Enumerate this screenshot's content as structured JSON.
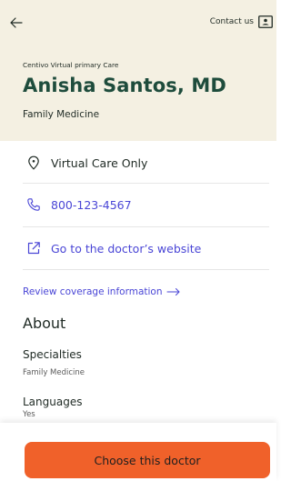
{
  "header": {
    "contact_label": "Contact us",
    "org": "Centivo Virtual primary Care",
    "doctor_name": "Anisha Santos, MD",
    "specialty": "Family Medicine"
  },
  "details": {
    "location": "Virtual Care Only",
    "phone": "800-123-4567",
    "website": "Go to the doctor’s website"
  },
  "links": {
    "review_coverage": "Review coverage information"
  },
  "about": {
    "heading": "About",
    "specialties_label": "Specialties",
    "specialties_value": "Family Medicine",
    "languages_label": "Languages",
    "languages_value": "Yes"
  },
  "footer": {
    "cta_label": "Choose this doctor"
  },
  "colors": {
    "header_bg": "#f4f0e2",
    "name": "#1e4c3c",
    "link": "#4a46d6",
    "cta": "#f0612a"
  },
  "icons": [
    "back-arrow-icon",
    "contact-card-icon",
    "location-pin-icon",
    "phone-icon",
    "external-link-icon",
    "arrow-right-icon"
  ]
}
